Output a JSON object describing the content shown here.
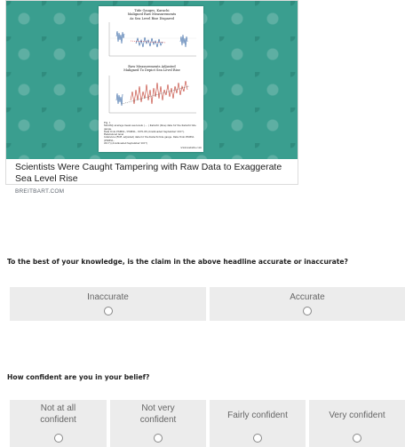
{
  "card": {
    "headline": "Scientists Were Caught Tampering with Raw Data to Exaggerate Sea Level Rise",
    "domain": "BREITBART.COM",
    "figure": {
      "top_title": "Tide Gauges, Karachi\nMaligned Raw Measurements\nAs Sea Level Rise Dispared",
      "bottom_title": "Raw Measurements Adjusted\nMaligned To Depict Sea Level Rise",
      "caption": "Fig. 1\nMonthly average mean sea levels ( ... ) Karachi (blue) data for the Karachi tide gauge.\nData from PSMSL / PSMSL, 1970-06 (downloaded September 2017). Referenced level\nreference (RLR, adjusted) data for the Karachi tide gauge. Data from PSMSL (PSMSL,\n2017) (downloaded September 2017)",
      "credit": "www.website.com"
    }
  },
  "question1": {
    "text": "To the best of your knowledge, is the claim in the above headline accurate or inaccurate?",
    "options": [
      "Inaccurate",
      "Accurate"
    ]
  },
  "question2": {
    "text": "How confident are you in your belief?",
    "options": [
      "Not at all confident",
      "Not very confident",
      "Fairly confident",
      "Very confident"
    ]
  }
}
